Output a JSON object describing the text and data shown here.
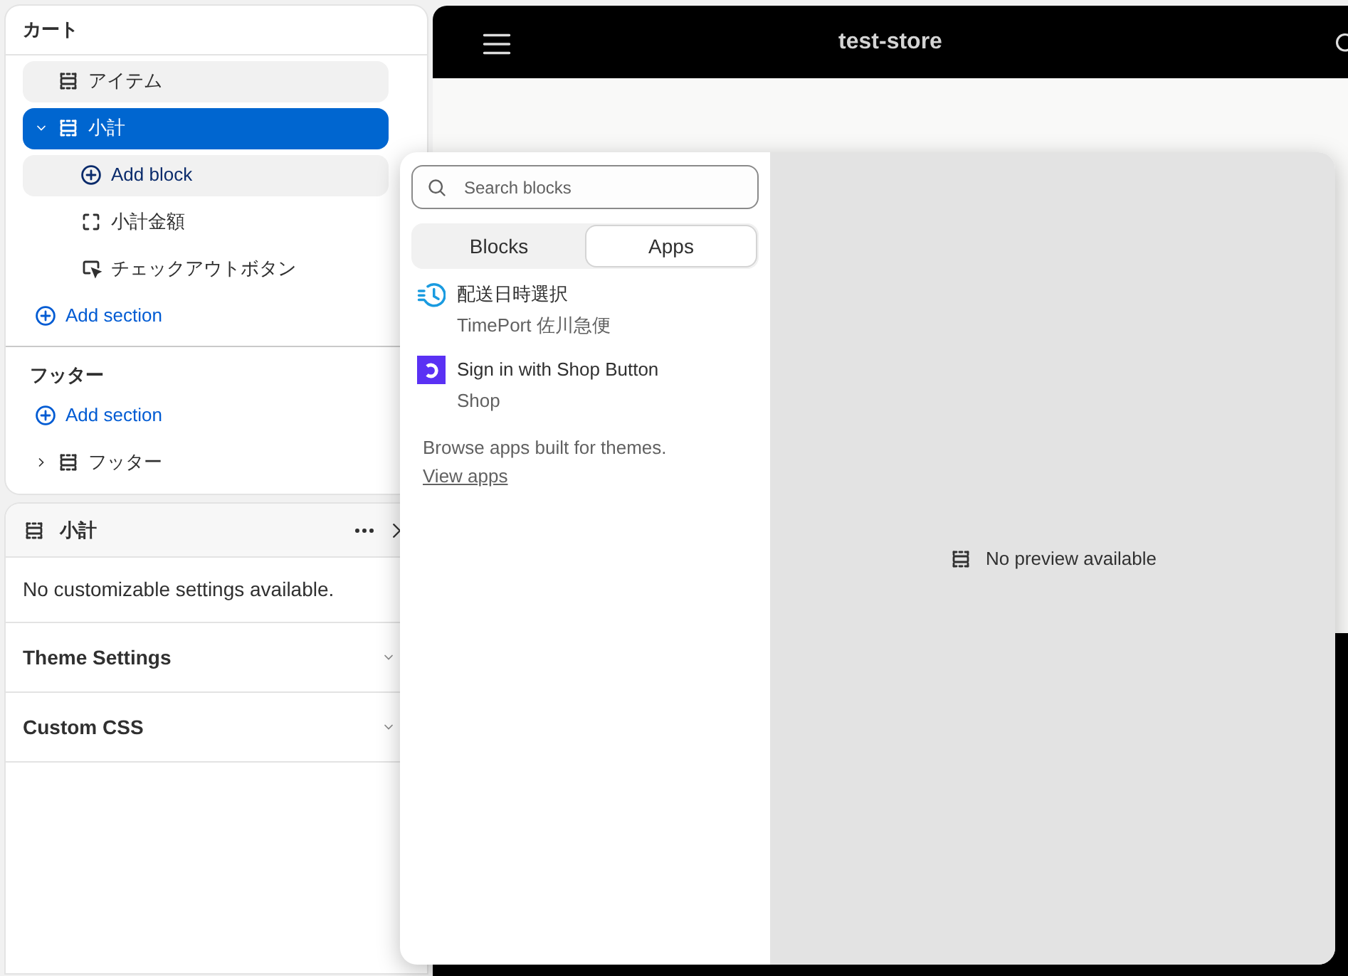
{
  "sections_panel": {
    "groups": [
      {
        "title": "カート",
        "items": [
          {
            "kind": "section",
            "label": "アイテム",
            "selected": false,
            "highlighted": true
          },
          {
            "kind": "section",
            "label": "小計",
            "selected": true,
            "highlighted": false,
            "expanded": true,
            "children": [
              {
                "kind": "add-block",
                "label": "Add block",
                "highlighted": true
              },
              {
                "kind": "block",
                "label": "小計金額",
                "highlighted": false
              },
              {
                "kind": "button",
                "label": "チェックアウトボタン",
                "highlighted": false
              }
            ]
          },
          {
            "kind": "add-section",
            "label": "Add section",
            "highlighted": false
          }
        ]
      },
      {
        "title": "フッター",
        "items": [
          {
            "kind": "add-section",
            "label": "Add section",
            "highlighted": false
          },
          {
            "kind": "section",
            "label": "フッター",
            "selected": false,
            "highlighted": false,
            "expanded": false
          }
        ]
      }
    ]
  },
  "settings_panel": {
    "title": "小計",
    "message": "No customizable settings available.",
    "accordions": [
      {
        "label": "Theme Settings",
        "expanded": false
      },
      {
        "label": "Custom CSS",
        "expanded": false
      }
    ]
  },
  "preview": {
    "store_name": "test-store"
  },
  "block_picker": {
    "search": {
      "placeholder": "Search blocks"
    },
    "tabs": [
      {
        "label": "Blocks",
        "selected": false
      },
      {
        "label": "Apps",
        "selected": true
      }
    ],
    "apps": [
      {
        "kind": "clock",
        "name": "配送日時選択",
        "vendor": "TimePort 佐川急便"
      },
      {
        "kind": "shop",
        "name": "Sign in with Shop Button",
        "vendor": "Shop"
      }
    ],
    "footer": {
      "text": "Browse apps built for themes.",
      "link": "View apps"
    },
    "preview_message": "No preview available"
  }
}
